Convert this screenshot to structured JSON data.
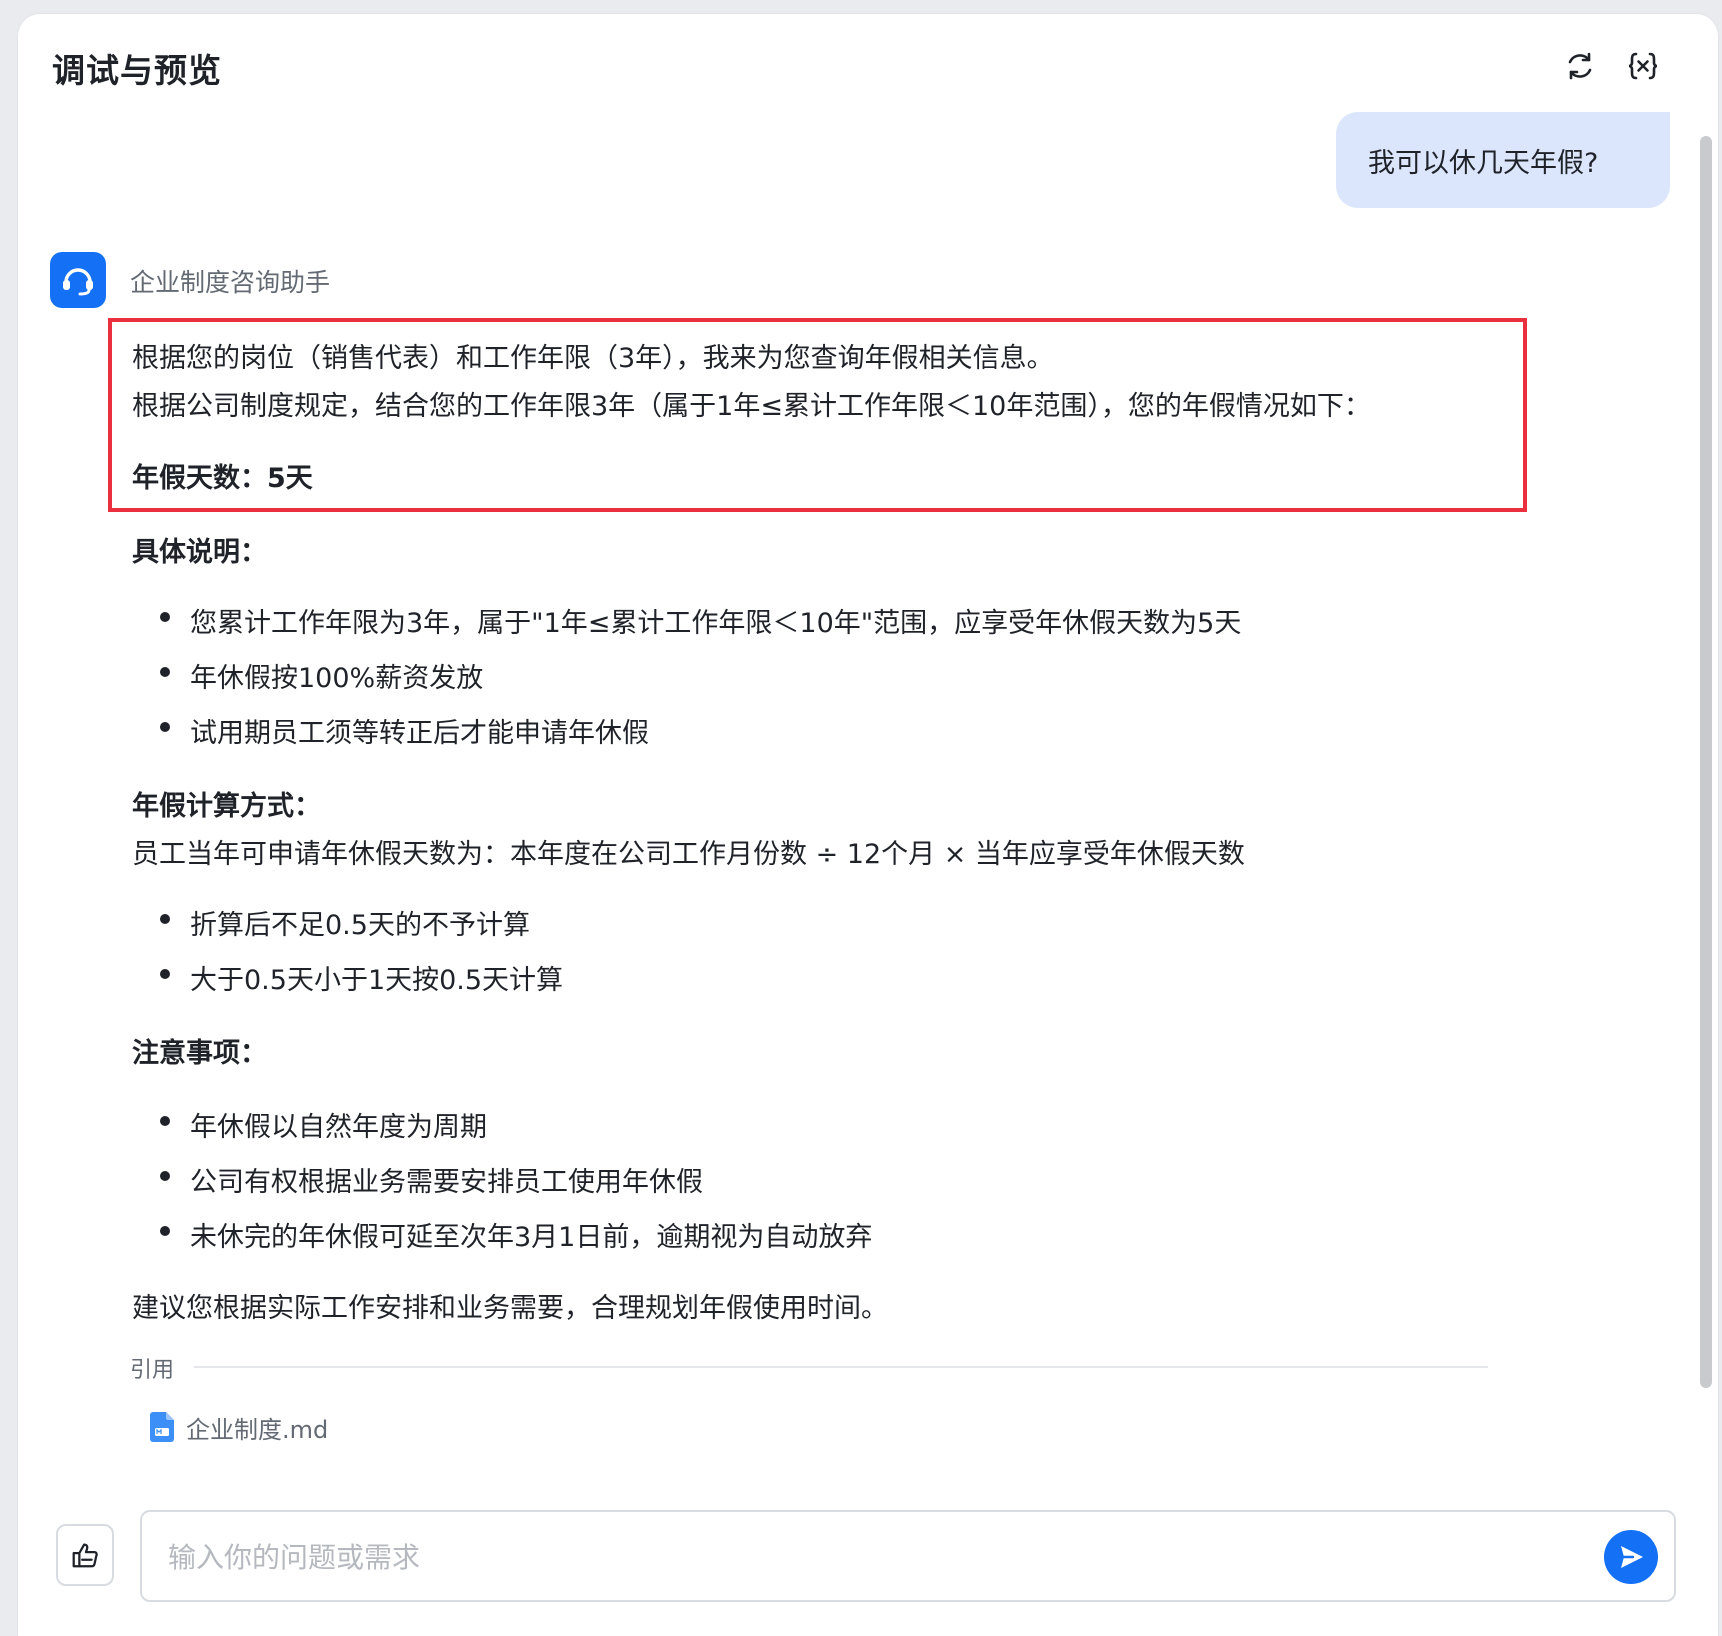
{
  "header": {
    "title": "调试与预览",
    "refresh_icon": "refresh-icon",
    "variable_icon": "variable-braces-icon"
  },
  "user_message": "我可以休几天年假?",
  "assistant": {
    "name": "企业制度咨询助手",
    "avatar_icon": "headset-icon",
    "paragraph1": "根据您的岗位（销售代表）和工作年限（3年），我来为您查询年假相关信息。",
    "paragraph2": "根据公司制度规定，结合您的工作年限3年（属于1年≤累计工作年限＜10年范围），您的年假情况如下：",
    "annual_leave": "年假天数：5天",
    "section1_title": "具体说明：",
    "section1_items": [
      "您累计工作年限为3年，属于\"1年≤累计工作年限＜10年\"范围，应享受年休假天数为5天",
      "年休假按100%薪资发放",
      "试用期员工须等转正后才能申请年休假"
    ],
    "section2_title": "年假计算方式：",
    "section2_formula": "员工当年可申请年休假天数为：本年度在公司工作月份数 ÷ 12个月 × 当年应享受年休假天数",
    "section2_items": [
      "折算后不足0.5天的不予计算",
      "大于0.5天小于1天按0.5天计算"
    ],
    "section3_title": "注意事项：",
    "section3_items": [
      "年休假以自然年度为周期",
      "公司有权根据业务需要安排员工使用年休假",
      "未休完的年休假可延至次年3月1日前，逾期视为自动放弃"
    ],
    "conclusion": "建议您根据实际工作安排和业务需要，合理规划年假使用时间。",
    "reference_label": "引用",
    "reference_file": "企业制度.md"
  },
  "composer": {
    "placeholder": "输入你的问题或需求",
    "value": ""
  },
  "colors": {
    "accent": "#1471f5",
    "user_bubble": "#dbe5fb",
    "highlight_border": "#ea2f3e"
  }
}
